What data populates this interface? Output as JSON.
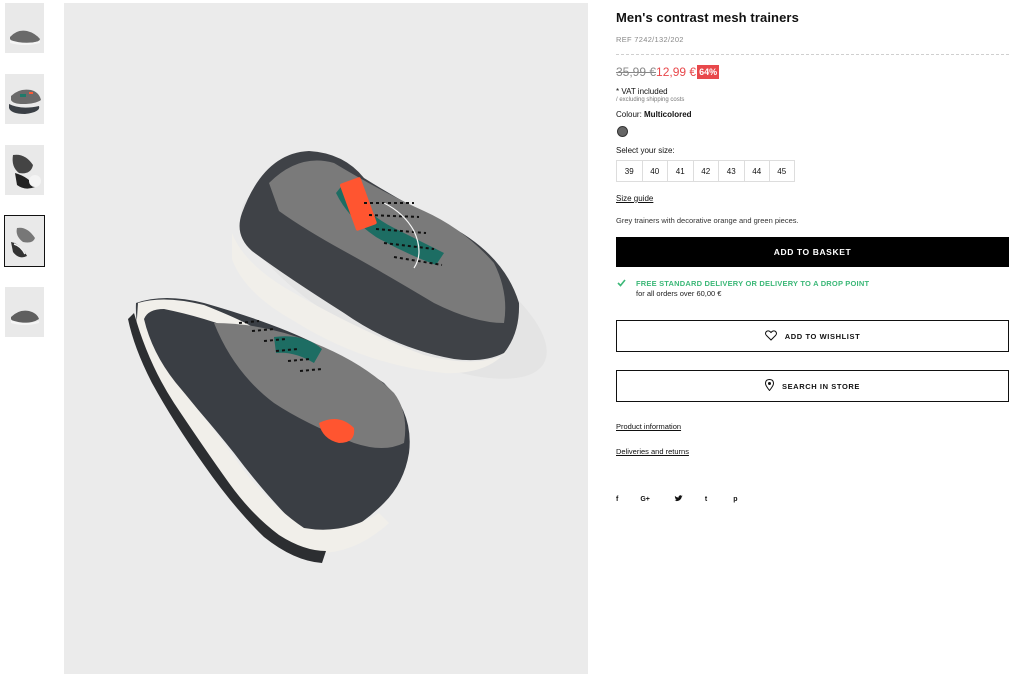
{
  "product": {
    "title": "Men's contrast mesh trainers",
    "ref": "REF 7242/132/202",
    "old_price": "35,99 €",
    "new_price": "12,99 €",
    "discount": "64%",
    "vat": "* VAT included",
    "shipping_note": "/ excluding shipping costs",
    "colour_label": "Colour: ",
    "colour_value": "Multicolored",
    "swatch_color": "#666666",
    "size_label": "Select your size:",
    "sizes": [
      "39",
      "40",
      "41",
      "42",
      "43",
      "44",
      "45"
    ],
    "size_guide": "Size guide",
    "description": "Grey trainers with decorative orange and green pieces."
  },
  "actions": {
    "add_to_basket": "ADD TO BASKET",
    "add_to_wishlist": "ADD TO WISHLIST",
    "search_in_store": "SEARCH IN STORE"
  },
  "delivery": {
    "title": "FREE STANDARD DELIVERY OR DELIVERY TO A DROP POINT",
    "subtitle": "for all orders over 60,00 €"
  },
  "links": {
    "product_information": "Product information",
    "deliveries_and_returns": "Deliveries and returns"
  },
  "social": {
    "icons": [
      "facebook-icon",
      "google-plus-icon",
      "twitter-icon",
      "tumblr-icon",
      "pinterest-icon"
    ],
    "glyphs": [
      "f",
      "G+",
      "t",
      "t",
      "p"
    ]
  },
  "gallery": {
    "thumbnail_count": 5,
    "active_index": 3
  },
  "colors": {
    "accent_red": "#e8484b",
    "delivery_green": "#3cb878",
    "button_black": "#000000"
  }
}
